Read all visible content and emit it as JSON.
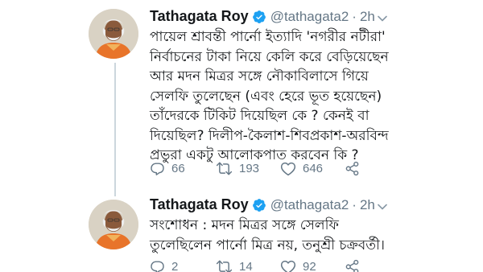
{
  "tweets": [
    {
      "author_name": "Tathagata Roy",
      "handle": "@tathagata2",
      "separator": "·",
      "time": "2h",
      "text_lines": [
        "পায়েল শ্রাবন্তী পার্নো ইত্যাদি 'নগরীর নটীরা'",
        "নির্বাচনের টাকা নিয়ে কেলি করে বেড়িয়েছেন",
        "আর মদন মিত্রর সঙ্গে নৌকাবিলাসে গিয়ে",
        "সেলফি তুলেছেন (এবং হেরে ভূত হয়েছেন)",
        "তাঁদেরকে টিকিট দিয়েছিল কে ? কেনই বা",
        "দিয়েছিল? দিলীপ-কৈলাশ-শিবপ্রকাশ-অরবিন্দ",
        "প্রভুরা একটু আলোকপাত করবেন কি ?"
      ],
      "replies": "66",
      "retweets": "193",
      "likes": "646"
    },
    {
      "author_name": "Tathagata Roy",
      "handle": "@tathagata2",
      "separator": "·",
      "time": "2h",
      "text_lines": [
        "সংশোধন : মদন মিত্রর সঙ্গে সেলফি",
        "তুলেছিলেন পার্নো মিত্র নয়, তনুশ্রী চক্রবর্তী।"
      ],
      "replies": "2",
      "retweets": "14",
      "likes": "92"
    }
  ],
  "colors": {
    "verified": "#1da1f2",
    "secondary_text": "#657786",
    "thread_line": "#ccd6dd"
  },
  "icons": [
    "verified-badge-icon",
    "chevron-down-icon",
    "reply-icon",
    "retweet-icon",
    "like-icon",
    "share-icon"
  ]
}
